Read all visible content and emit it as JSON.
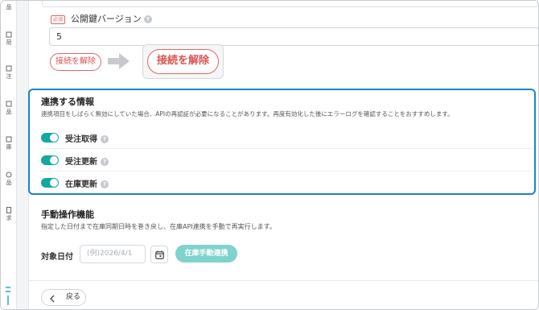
{
  "sidebar": {
    "items": [
      {
        "label": "品",
        "icon": "box-icon"
      },
      {
        "label": "荷",
        "icon": "truck-icon"
      },
      {
        "label": "注",
        "icon": "cart-icon"
      },
      {
        "label": "品",
        "icon": "tag-icon"
      },
      {
        "label": "庫",
        "icon": "warehouse-icon"
      },
      {
        "label": "品",
        "icon": "cycle-icon"
      },
      {
        "label": "求",
        "icon": "invoice-icon"
      }
    ]
  },
  "auth": {
    "required_badge": "必須",
    "version_label": "公開鍵バージョン",
    "version_value": "5",
    "disconnect_label": "接続を解除",
    "disconnect_zoom_label": "接続を解除"
  },
  "sync": {
    "title": "連携する情報",
    "description": "連携項目をしばらく無効にしていた場合、APIの再認証が必要になることがあります。再度有効化した後にエラーログを確認することをおすすめします。",
    "toggles": [
      {
        "label": "受注取得",
        "enabled": true
      },
      {
        "label": "受注更新",
        "enabled": true
      },
      {
        "label": "在庫更新",
        "enabled": true
      }
    ]
  },
  "manual": {
    "title": "手動操作機能",
    "description": "指定した日付まで在庫同期日時を巻き戻し、在庫API連携を手動で再実行します。",
    "date_label": "対象日付",
    "date_placeholder": "(例)2026/4/1",
    "sync_button": "在庫手動連携"
  },
  "footer": {
    "back_label": "戻る"
  },
  "colors": {
    "accent_blue": "#1a84c7",
    "toggle_on": "#13a8a0",
    "danger": "#d9534f",
    "button_disabled": "#7fd2cd"
  }
}
